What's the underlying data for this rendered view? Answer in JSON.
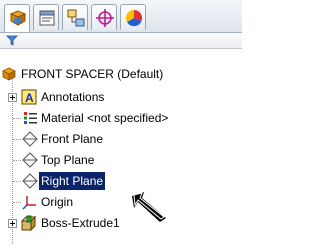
{
  "tabs": [
    {
      "icon": "feature-manager-icon"
    },
    {
      "icon": "property-manager-icon"
    },
    {
      "icon": "configuration-manager-icon"
    },
    {
      "icon": "dimxpert-manager-icon"
    },
    {
      "icon": "display-manager-icon"
    }
  ],
  "filter": {
    "icon": "filter-icon"
  },
  "tree": {
    "root": {
      "label": "FRONT SPACER  (Default)",
      "icon": "part-icon"
    },
    "items": [
      {
        "label": "Annotations",
        "icon": "annotations-icon",
        "expandable": true
      },
      {
        "label": "Material <not specified>",
        "icon": "material-icon",
        "expandable": false
      },
      {
        "label": "Front Plane",
        "icon": "plane-icon",
        "expandable": false
      },
      {
        "label": "Top Plane",
        "icon": "plane-icon",
        "expandable": false
      },
      {
        "label": "Right Plane",
        "icon": "plane-icon",
        "expandable": false,
        "selected": true
      },
      {
        "label": "Origin",
        "icon": "origin-icon",
        "expandable": false
      },
      {
        "label": "Boss-Extrude1",
        "icon": "extrude-icon",
        "expandable": true
      }
    ]
  },
  "colors": {
    "selection": "#0a246a",
    "accent": "#d98a00"
  }
}
